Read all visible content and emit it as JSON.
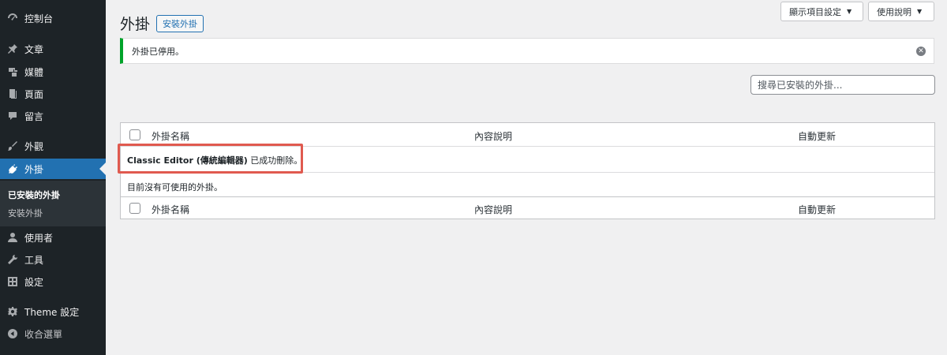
{
  "sidebar": {
    "items": [
      {
        "label": "控制台",
        "icon": "dashboard-icon"
      },
      {
        "label": "文章",
        "icon": "pin-icon"
      },
      {
        "label": "媒體",
        "icon": "media-icon"
      },
      {
        "label": "頁面",
        "icon": "page-icon"
      },
      {
        "label": "留言",
        "icon": "comment-icon"
      },
      {
        "label": "外觀",
        "icon": "brush-icon"
      },
      {
        "label": "外掛",
        "icon": "plugin-icon"
      },
      {
        "label": "使用者",
        "icon": "user-icon"
      },
      {
        "label": "工具",
        "icon": "wrench-icon"
      },
      {
        "label": "設定",
        "icon": "settings-icon"
      },
      {
        "label": "Theme 設定",
        "icon": "gear-icon"
      },
      {
        "label": "收合選單",
        "icon": "collapse-icon"
      }
    ],
    "submenu": [
      {
        "label": "已安裝的外掛"
      },
      {
        "label": "安裝外掛"
      }
    ]
  },
  "header": {
    "screen_options": "顯示項目設定",
    "help": "使用說明",
    "title": "外掛",
    "add_new": "安裝外掛"
  },
  "notice": {
    "text": "外掛已停用。"
  },
  "search": {
    "placeholder": "搜尋已安裝的外掛..."
  },
  "table": {
    "columns": [
      "外掛名稱",
      "內容說明",
      "自動更新"
    ],
    "deleted_plugin": "Classic Editor (傳統編輯器)",
    "deleted_suffix": " 已成功刪除。",
    "empty_message": "目前沒有可使用的外掛。"
  },
  "colors": {
    "sidebar_bg": "#1d2327",
    "accent": "#2271b1",
    "notice_success": "#00a32a",
    "highlight": "#e05a4f"
  }
}
